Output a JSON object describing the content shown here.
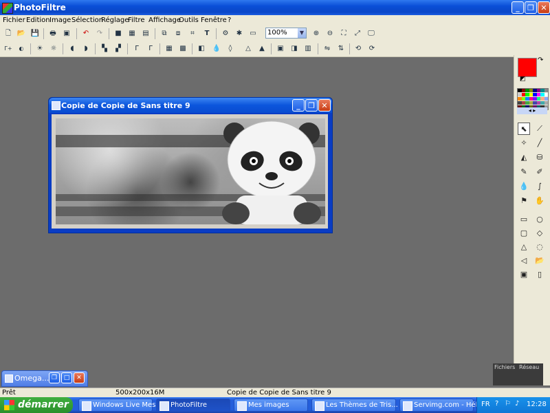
{
  "app": {
    "title": "PhotoFiltre"
  },
  "menu": [
    "Fichier",
    "Edition",
    "Image",
    "Sélection",
    "Réglage",
    "Filtre",
    "Affichage",
    "Outils",
    "Fenêtre",
    "?"
  ],
  "toolbar": {
    "zoom_value": "100%"
  },
  "palette": {
    "fg_color": "#ff0000",
    "bg_color": "#ffffff"
  },
  "document": {
    "title": "Copie de Copie de Sans titre 9"
  },
  "minimized": {
    "title": "Omega..."
  },
  "layers": {
    "tab1": "Fichiers",
    "tab2": "Réseau"
  },
  "status": {
    "left": "Prêt",
    "size": "500x200x16M",
    "doc": "Copie de Copie de Sans titre 9"
  },
  "taskbar": {
    "start": "démarrer",
    "items": [
      "Windows Live Mess...",
      "PhotoFiltre",
      "Mes images",
      "Les Thèmes de Tris...",
      "Servimg.com - Héb..."
    ],
    "lang": "FR",
    "time": "12:28"
  }
}
